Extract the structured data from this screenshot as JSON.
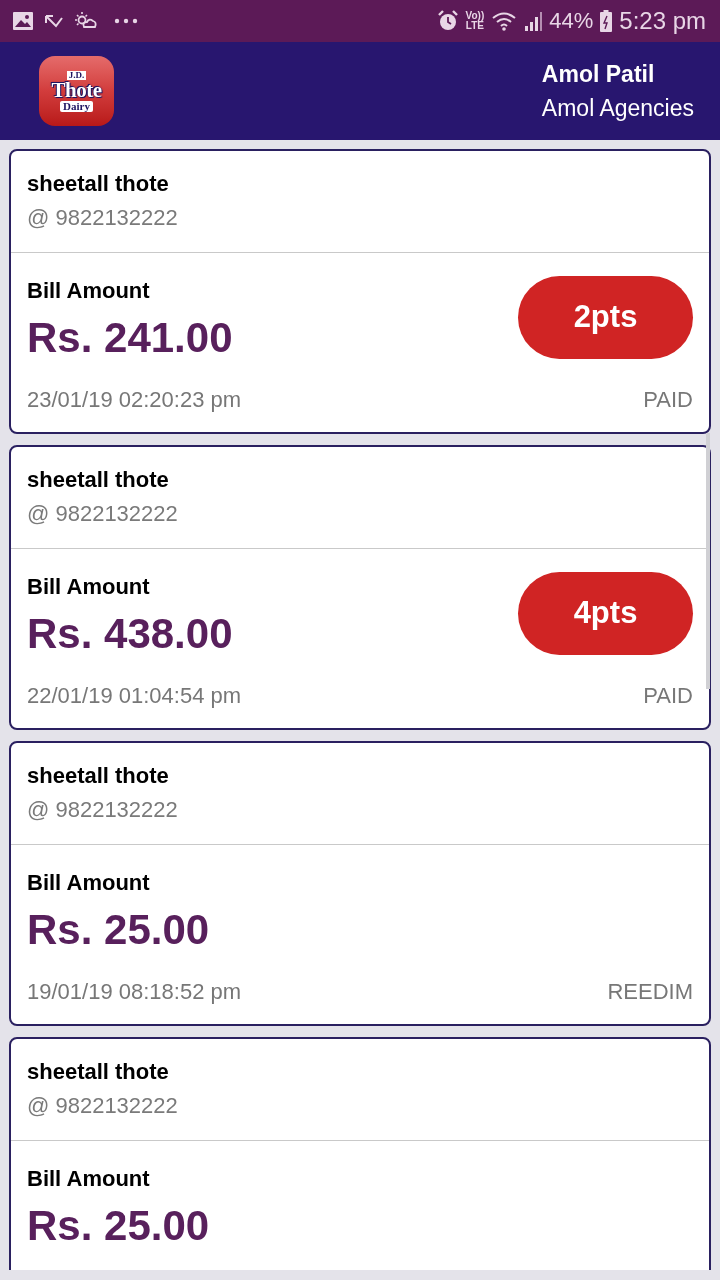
{
  "status_bar": {
    "network_label": {
      "top": "Vo))",
      "bottom": "LTE"
    },
    "battery": "44%",
    "time": "5:23 pm"
  },
  "header": {
    "logo": {
      "lines": [
        "J.D.",
        "Thote",
        "Dairy"
      ]
    },
    "user_name": "Amol Patil",
    "agency": "Amol Agencies"
  },
  "bills": [
    {
      "customer": "sheetall thote",
      "phone": "@ 9822132222",
      "label": "Bill Amount",
      "amount": "Rs. 241.00",
      "points": "2pts",
      "date": "23/01/19 02:20:23 pm",
      "status": "PAID"
    },
    {
      "customer": "sheetall thote",
      "phone": "@ 9822132222",
      "label": "Bill Amount",
      "amount": "Rs. 438.00",
      "points": "4pts",
      "date": "22/01/19 01:04:54 pm",
      "status": "PAID"
    },
    {
      "customer": "sheetall thote",
      "phone": "@ 9822132222",
      "label": "Bill Amount",
      "amount": "Rs. 25.00",
      "date": "19/01/19 08:18:52 pm",
      "status": "REEDIM"
    },
    {
      "customer": "sheetall thote",
      "phone": "@ 9822132222",
      "label": "Bill Amount",
      "amount": "Rs. 25.00"
    }
  ]
}
